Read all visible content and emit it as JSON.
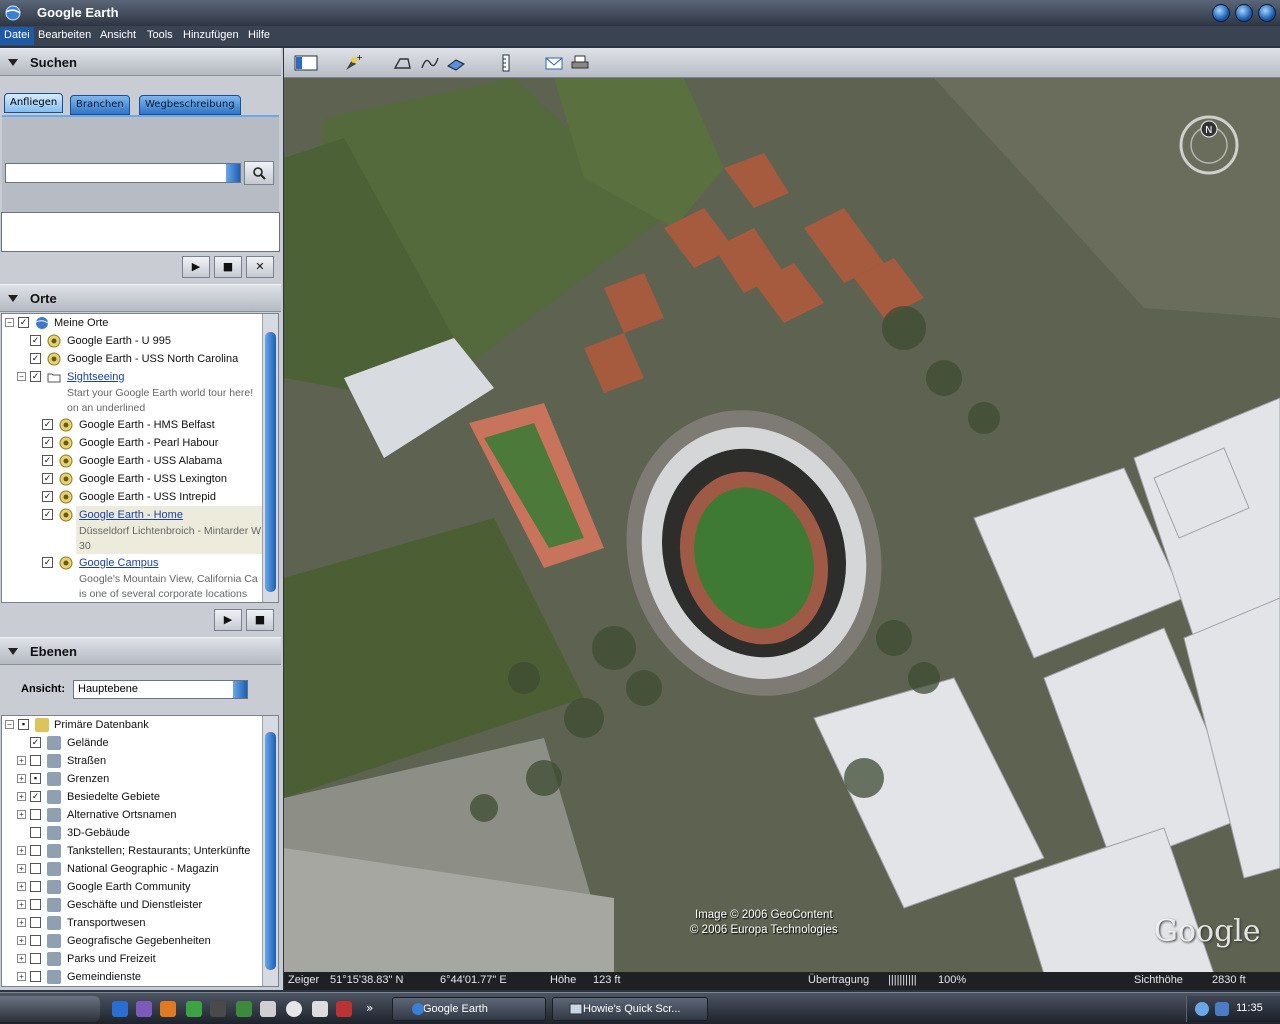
{
  "window": {
    "title": "Google Earth"
  },
  "menu": [
    "Datei",
    "Bearbeiten",
    "Ansicht",
    "Tools",
    "Hinzufügen",
    "Hilfe"
  ],
  "search": {
    "header": "Suchen",
    "tabs": [
      "Anfliegen",
      "Branchen",
      "Wegbeschreibung"
    ],
    "input_value": "",
    "search_icon": "magnifier-icon"
  },
  "places": {
    "header": "Orte",
    "items": [
      {
        "label": "Meine Orte",
        "checked": true
      },
      {
        "label": "Google Earth - U 995",
        "checked": true
      },
      {
        "label": "Google Earth - USS North Carolina",
        "checked": true
      },
      {
        "label": "Sightseeing",
        "checked": true,
        "link": true
      },
      {
        "desc1": "Start your Google Earth world tour here!",
        "desc2": "on an underlined"
      },
      {
        "label": "Google Earth - HMS Belfast",
        "checked": true
      },
      {
        "label": "Google Earth - Pearl Habour",
        "checked": true
      },
      {
        "label": "Google Earth - USS Alabama",
        "checked": true
      },
      {
        "label": "Google Earth - USS Lexington",
        "checked": true
      },
      {
        "label": "Google Earth - USS Intrepid",
        "checked": true
      },
      {
        "label": "Google Earth - Home",
        "checked": true,
        "link": true,
        "desc1": "Düsseldorf Lichtenbroich - Mintarder W",
        "desc2": "30"
      },
      {
        "label": "Google Campus",
        "checked": true,
        "link": true,
        "desc1": "Google's Mountain View, California Ca",
        "desc2": "is one of several corporate locations"
      }
    ]
  },
  "layers": {
    "header": "Ebenen",
    "view_label": "Ansicht:",
    "view_value": "Hauptebene",
    "items": [
      {
        "label": "Primäre Datenbank",
        "checked": "partial"
      },
      {
        "label": "Gelände",
        "checked": true
      },
      {
        "label": "Straßen",
        "checked": false
      },
      {
        "label": "Grenzen",
        "checked": "partial"
      },
      {
        "label": "Besiedelte Gebiete",
        "checked": true
      },
      {
        "label": "Alternative Ortsnamen",
        "checked": false
      },
      {
        "label": "3D-Gebäude",
        "checked": false
      },
      {
        "label": "Tankstellen; Restaurants; Unterkünfte",
        "checked": false
      },
      {
        "label": "National Geographic - Magazin",
        "checked": false
      },
      {
        "label": "Google Earth Community",
        "checked": false
      },
      {
        "label": "Geschäfte und Dienstleister",
        "checked": false
      },
      {
        "label": "Transportwesen",
        "checked": false
      },
      {
        "label": "Geografische Gegebenheiten",
        "checked": false
      },
      {
        "label": "Parks und Freizeit",
        "checked": false
      },
      {
        "label": "Gemeindienste",
        "checked": false
      }
    ]
  },
  "map": {
    "copyright1": "Image © 2006 GeoContent",
    "copyright2": "© 2006 Europa Technologies",
    "watermark": "Google",
    "compass_label": "N"
  },
  "status": {
    "pointer_label": "Zeiger",
    "lat": "51°15'38.83\"  N",
    "lon": "6°44'01.77\"  E",
    "height_label": "Höhe",
    "height": "123 ft",
    "stream_label": "Übertragung",
    "stream_bars": "||||||||||",
    "stream_pct": "100%",
    "eye_label": "Sichthöhe",
    "eye": "2830 ft"
  },
  "taskbar": {
    "tasks": [
      "Google Earth",
      "Howie's Quick Scr..."
    ],
    "more": "»",
    "clock": "11:35"
  }
}
